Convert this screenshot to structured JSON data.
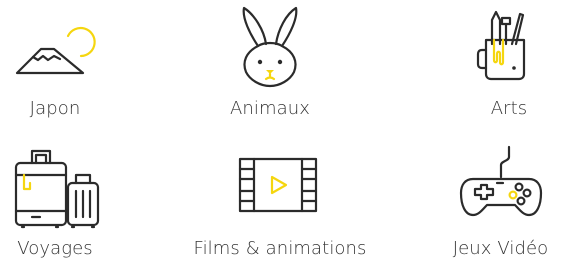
{
  "categories": [
    {
      "label": "Japon",
      "icon": "mount-fuji-icon"
    },
    {
      "label": "Animaux",
      "icon": "rabbit-icon"
    },
    {
      "label": "Arts",
      "icon": "art-supplies-cup-icon"
    },
    {
      "label": "Voyages",
      "icon": "luggage-icon"
    },
    {
      "label": "Films & animations",
      "icon": "film-strip-icon"
    },
    {
      "label": "Jeux Vidéo",
      "icon": "game-controller-icon"
    }
  ],
  "colors": {
    "stroke": "#2b2b2b",
    "accent": "#f5d60f",
    "label": "#333333"
  }
}
